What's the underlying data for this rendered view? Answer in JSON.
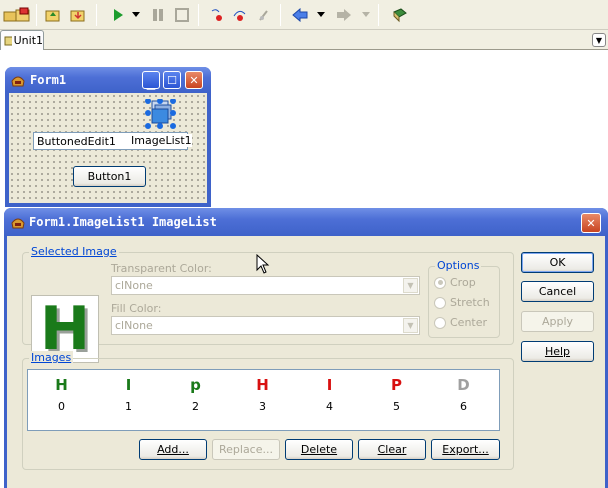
{
  "ide": {
    "tabs": [
      {
        "label": "Unit1"
      }
    ],
    "toolbar_icons": [
      "open-icon",
      "save-icon",
      "open-project-icon",
      "save-all-icon",
      "run-icon",
      "run-dropdown-icon",
      "pause-icon",
      "stop-icon",
      "step-into-icon",
      "step-over-icon",
      "run-to-cursor-icon",
      "back-icon",
      "back-dropdown-icon",
      "forward-icon",
      "forward-dropdown-icon",
      "help-book-icon"
    ]
  },
  "form1": {
    "title": "Form1",
    "components": {
      "buttoned_edit": "ButtonedEdit1",
      "image_list": "ImageList1",
      "button": "Button1"
    }
  },
  "dialog": {
    "title": "Form1.ImageList1 ImageList",
    "selected_image_group": "Selected Image",
    "transparent_color_label": "Transparent Color:",
    "transparent_color_value": "clNone",
    "fill_color_label": "Fill Color:",
    "fill_color_value": "clNone",
    "options_group": "Options",
    "options": [
      {
        "label": "Crop",
        "checked": true
      },
      {
        "label": "Stretch",
        "checked": false
      },
      {
        "label": "Center",
        "checked": false
      }
    ],
    "preview_glyph": "H",
    "images_group": "Images",
    "images": [
      {
        "glyph": "H",
        "index": "0",
        "color": "#1a7a1a"
      },
      {
        "glyph": "I",
        "index": "1",
        "color": "#1a7a1a"
      },
      {
        "glyph": "p",
        "index": "2",
        "color": "#1a7a1a"
      },
      {
        "glyph": "H",
        "index": "3",
        "color": "#d81010"
      },
      {
        "glyph": "I",
        "index": "4",
        "color": "#d81010"
      },
      {
        "glyph": "P",
        "index": "5",
        "color": "#d81010"
      },
      {
        "glyph": "D",
        "index": "6",
        "color": "#a0a0a0"
      }
    ],
    "buttons": {
      "ok": "OK",
      "cancel": "Cancel",
      "apply": "Apply",
      "help": "Help",
      "add": "Add...",
      "replace": "Replace...",
      "delete": "Delete",
      "clear": "Clear",
      "export": "Export..."
    }
  }
}
